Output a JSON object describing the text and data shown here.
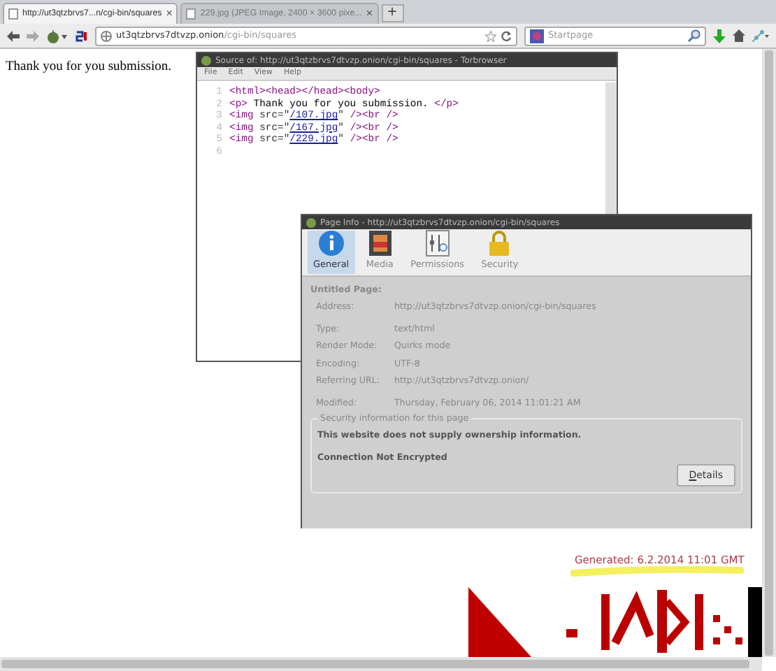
{
  "browser": {
    "tabs": [
      {
        "title": "http://ut3qtzbrvs7...n/cgi-bin/squares",
        "selected": true,
        "close": "×"
      },
      {
        "title": "229.jpg (JPEG Image, 2400 × 3600 pixe...",
        "selected": false,
        "close": "×"
      }
    ],
    "new_tab": "+",
    "address": {
      "host": "ut3qtzbrvs7dtvzp.onion",
      "path": "/cgi-bin/squares"
    },
    "search": {
      "placeholder": "Startpage"
    }
  },
  "page": {
    "text": "Thank you for you submission.",
    "generated": "Generated: 6.2.2014 11:01 GMT"
  },
  "source_window": {
    "title": "Source of: http://ut3qtzbrvs7dtvzp.onion/cgi-bin/squares - Torbrowser",
    "menu": [
      "File",
      "Edit",
      "View",
      "Help"
    ],
    "lines": [
      {
        "number": "1",
        "tokens": [
          {
            "kind": "tag",
            "text": "<html><head></head><body>"
          }
        ]
      },
      {
        "number": "2",
        "tokens": [
          {
            "kind": "tag",
            "text": "<p>"
          },
          {
            "kind": "text",
            "text": " Thank you for you submission. "
          },
          {
            "kind": "tag",
            "text": "</p>"
          }
        ]
      },
      {
        "number": "3",
        "tokens": [
          {
            "kind": "tag",
            "text": "<img"
          },
          {
            "kind": "attr",
            "text": " src=\""
          },
          {
            "kind": "link",
            "text": "/107.jpg"
          },
          {
            "kind": "attr",
            "text": "\""
          },
          {
            "kind": "tag",
            "text": " /><br />"
          }
        ]
      },
      {
        "number": "4",
        "tokens": [
          {
            "kind": "tag",
            "text": "<img"
          },
          {
            "kind": "attr",
            "text": " src=\""
          },
          {
            "kind": "link",
            "text": "/167.jpg"
          },
          {
            "kind": "attr",
            "text": "\""
          },
          {
            "kind": "tag",
            "text": " /><br />"
          }
        ]
      },
      {
        "number": "5",
        "tokens": [
          {
            "kind": "tag",
            "text": "<img"
          },
          {
            "kind": "attr",
            "text": " src=\""
          },
          {
            "kind": "link",
            "text": "/229.jpg"
          },
          {
            "kind": "attr",
            "text": "\""
          },
          {
            "kind": "tag",
            "text": " /><br />"
          }
        ]
      },
      {
        "number": "6"
      }
    ]
  },
  "page_info": {
    "title": "Page Info - http://ut3qtzbrvs7dtvzp.onion/cgi-bin/squares",
    "tabs": [
      {
        "label": "General",
        "kind": "info",
        "selected": true
      },
      {
        "label": "Media",
        "kind": "media",
        "selected": false
      },
      {
        "label": "Permissions",
        "kind": "permissions",
        "selected": false
      },
      {
        "label": "Security",
        "kind": "security",
        "selected": false
      }
    ],
    "heading": "Untitled Page:",
    "fields": [
      {
        "label": "Address:",
        "value": "http://ut3qtzbrvs7dtvzp.onion/cgi-bin/squares"
      },
      {
        "label": "Type:",
        "value": "text/html"
      },
      {
        "label": "Render Mode:",
        "value": "Quirks mode"
      },
      {
        "label": "Encoding:",
        "value": "UTF-8"
      },
      {
        "label": "Referring URL:",
        "value": "http://ut3qtzbrvs7dtvzp.onion/"
      },
      {
        "label": "Modified:",
        "value": "Thursday, February 06, 2014 11:01:21 AM"
      }
    ],
    "security": {
      "legend": "Security information for this page",
      "ownership": "This website does not supply ownership information.",
      "connection": "Connection Not Encrypted",
      "button": "Details"
    }
  }
}
